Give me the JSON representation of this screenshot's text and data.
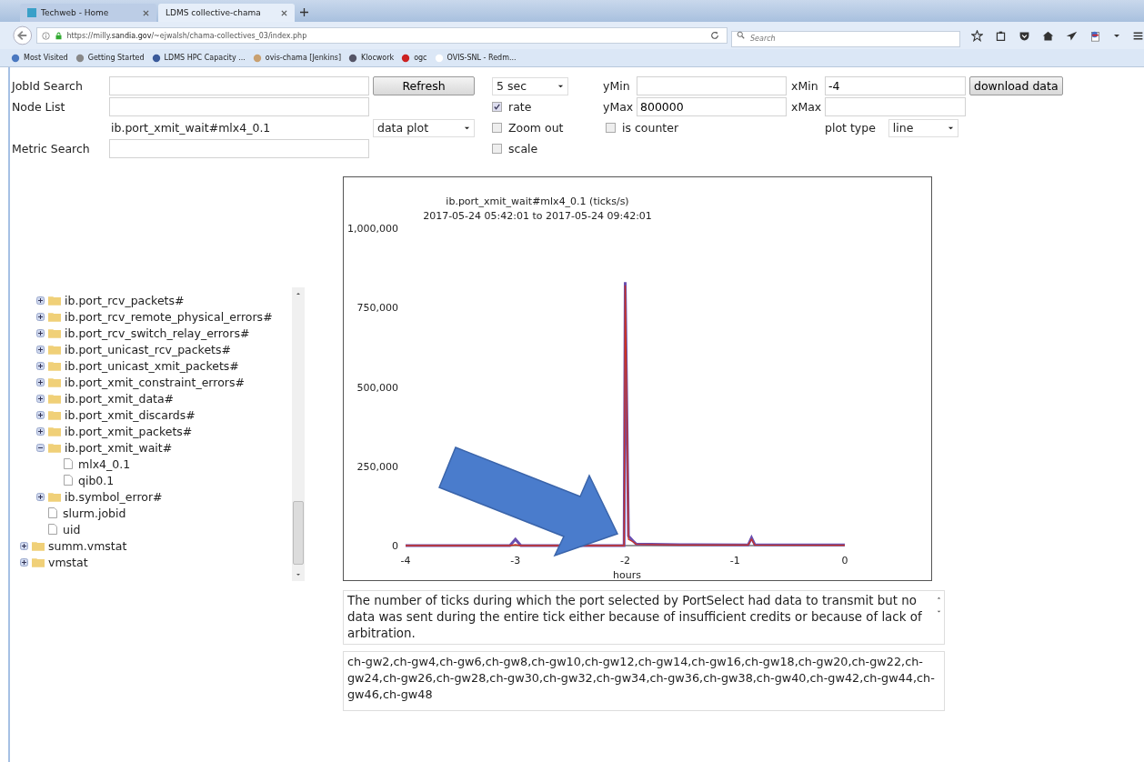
{
  "browser": {
    "tabs": [
      {
        "label": "Techweb - Home",
        "selected": false
      },
      {
        "label": "LDMS collective-chama",
        "selected": true
      }
    ],
    "url": {
      "prefix": "https://milly.",
      "domain": "sandia.gov",
      "rest": "/~ejwalsh/chama-collectives_03/index.php"
    },
    "search": {
      "placeholder": "Search"
    },
    "bookmarks": [
      "Most Visited",
      "Getting Started",
      "LDMS  HPC Capacity ...",
      "ovis-chama [Jenkins]",
      "Klocwork",
      "ogc",
      "OVIS-SNL - Redm..."
    ]
  },
  "form": {
    "jobid_label": "JobId Search",
    "refresh_button": "Refresh",
    "interval": "5 sec",
    "ymin_label": "yMin",
    "xmin_label": "xMin",
    "xmin_value": "-4",
    "download_button": "download data",
    "nodelist_label": "Node List",
    "rate_label": "rate",
    "rate_checked": true,
    "ymax_label": "yMax",
    "ymax_value": "800000",
    "xmax_label": "xMax",
    "metric_name": "ib.port_xmit_wait#mlx4_0.1",
    "view": "data plot",
    "zoomout_label": "Zoom out",
    "zoomout_checked": false,
    "counter_label": "is counter",
    "counter_checked": false,
    "plottype_label": "plot type",
    "plottype": "line",
    "metric_label": "Metric Search",
    "scale_label": "scale",
    "scale_checked": false
  },
  "tree": {
    "group_items": [
      {
        "label": "ib.port_rcv_packets#",
        "kind": "folder",
        "expanded": false
      },
      {
        "label": "ib.port_rcv_remote_physical_errors#",
        "kind": "folder",
        "expanded": false
      },
      {
        "label": "ib.port_rcv_switch_relay_errors#",
        "kind": "folder",
        "expanded": false
      },
      {
        "label": "ib.port_unicast_rcv_packets#",
        "kind": "folder",
        "expanded": false
      },
      {
        "label": "ib.port_unicast_xmit_packets#",
        "kind": "folder",
        "expanded": false
      },
      {
        "label": "ib.port_xmit_constraint_errors#",
        "kind": "folder",
        "expanded": false
      },
      {
        "label": "ib.port_xmit_data#",
        "kind": "folder",
        "expanded": false
      },
      {
        "label": "ib.port_xmit_discards#",
        "kind": "folder",
        "expanded": false
      },
      {
        "label": "ib.port_xmit_packets#",
        "kind": "folder",
        "expanded": false
      },
      {
        "label": "ib.port_xmit_wait#",
        "kind": "folder",
        "expanded": true,
        "children": [
          {
            "label": "mlx4_0.1",
            "kind": "file"
          },
          {
            "label": "qib0.1",
            "kind": "file"
          }
        ]
      },
      {
        "label": "ib.symbol_error#",
        "kind": "folder",
        "expanded": false
      },
      {
        "label": "slurm.jobid",
        "kind": "file"
      },
      {
        "label": "uid",
        "kind": "file"
      }
    ],
    "root_items": [
      {
        "label": "summ.vmstat",
        "kind": "folder",
        "expanded": false
      },
      {
        "label": "vmstat",
        "kind": "folder",
        "expanded": false
      }
    ]
  },
  "chart": {
    "subtitle": "2017-05-24 05:42:01 to 2017-05-24 09:42:01",
    "chart_data": {
      "type": "line",
      "title": "ib.port_xmit_wait#mlx4_0.1 (ticks/s)",
      "xlabel": "hours",
      "x": [
        -4,
        -3.05,
        -3.0,
        -2.95,
        -2.01,
        -2.0,
        -1.97,
        -1.93,
        -1.9,
        -1.5,
        -0.88,
        -0.85,
        -0.82,
        0
      ],
      "series": [
        {
          "color": "#6a4fb0",
          "values": [
            0,
            0,
            20000,
            0,
            0,
            830000,
            30000,
            15000,
            5000,
            3000,
            2000,
            25000,
            3000,
            2000
          ]
        },
        {
          "color": "#cc3322",
          "values": [
            0,
            0,
            3000,
            0,
            0,
            820000,
            20000,
            12000,
            4000,
            2000,
            2000,
            20000,
            2000,
            1000
          ]
        }
      ],
      "xlim": [
        -4,
        0
      ],
      "ylim": [
        0,
        1000000
      ],
      "xticks": [
        -4,
        -3,
        -2,
        -1,
        0
      ],
      "yticks": [
        {
          "value": 0,
          "label": "0"
        },
        {
          "value": 250000,
          "label": "250,000"
        },
        {
          "value": 500000,
          "label": "500,000"
        },
        {
          "value": 750000,
          "label": "750,000"
        },
        {
          "value": 1000000,
          "label": "1,000,000"
        }
      ]
    }
  },
  "description": "The number of ticks during which the port selected by PortSelect had data to transmit but no data was sent during  the entire tick either because of insufficient credits or because of lack of arbitration.",
  "nodes": "ch-gw2,ch-gw4,ch-gw6,ch-gw8,ch-gw10,ch-gw12,ch-gw14,ch-gw16,ch-gw18,ch-gw20,ch-gw22,ch-gw24,ch-gw26,ch-gw28,ch-gw30,ch-gw32,ch-gw34,ch-gw36,ch-gw38,ch-gw40,ch-gw42,ch-gw44,ch-gw46,ch-gw48"
}
